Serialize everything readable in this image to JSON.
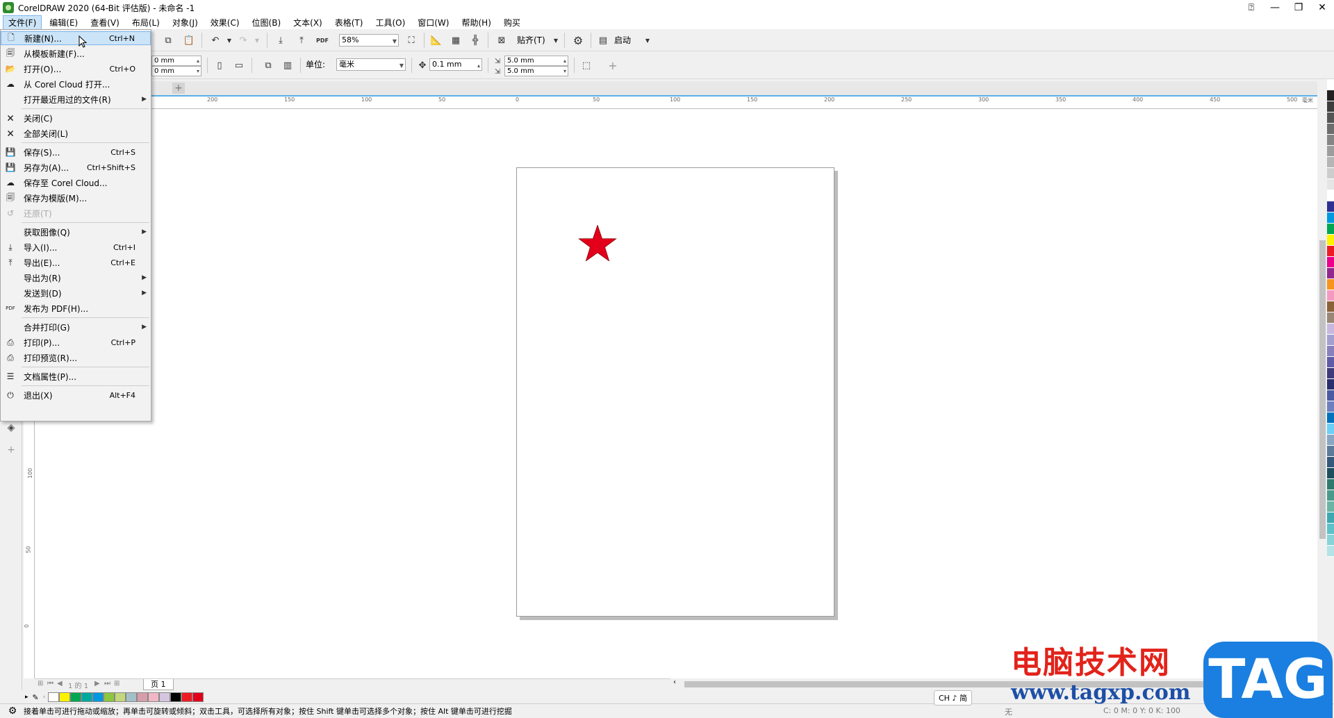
{
  "window": {
    "title": "CorelDRAW 2020 (64-Bit 评估版) - 未命名 -1",
    "controls": [
      "minimize-icon",
      "restore-icon",
      "close-icon"
    ]
  },
  "menubar": {
    "items": [
      "文件(F)",
      "编辑(E)",
      "查看(V)",
      "布局(L)",
      "对象(J)",
      "效果(C)",
      "位图(B)",
      "文本(X)",
      "表格(T)",
      "工具(O)",
      "窗口(W)",
      "帮助(H)",
      "购买"
    ],
    "active_index": 0
  },
  "toolbar1": {
    "zoom_value": "58%",
    "snap_label": "贴齐(T)",
    "launch_label": "启动",
    "pdf_label": "PDF"
  },
  "toolbar2": {
    "width_value": "0 mm",
    "height_value": "0 mm",
    "unit_label": "单位:",
    "unit_value": "毫米",
    "nudge_value": "0.1 mm",
    "dup_x_value": "5.0 mm",
    "dup_y_value": "5.0 mm"
  },
  "ruler": {
    "h_ticks": [
      "200",
      "150",
      "100",
      "50",
      "0",
      "50",
      "100",
      "150",
      "200",
      "250",
      "300",
      "350",
      "400",
      "450",
      "500"
    ],
    "h_unit": "毫米",
    "v_ticks": [
      "100",
      "50",
      "0"
    ]
  },
  "file_menu": {
    "items": [
      {
        "label": "新建(N)...",
        "shortcut": "Ctrl+N",
        "icon": "new-document-icon",
        "highlight": true
      },
      {
        "label": "从模板新建(F)...",
        "shortcut": "",
        "icon": "new-from-template-icon"
      },
      {
        "label": "打开(O)...",
        "shortcut": "Ctrl+O",
        "icon": "open-folder-icon"
      },
      {
        "label": "从 Corel Cloud 打开...",
        "shortcut": "",
        "icon": "cloud-download-icon"
      },
      {
        "label": "打开最近用过的文件(R)",
        "shortcut": "",
        "icon": "",
        "submenu": true
      },
      {
        "label": "关闭(C)",
        "shortcut": "",
        "icon": "close-document-icon"
      },
      {
        "label": "全部关闭(L)",
        "shortcut": "",
        "icon": "close-all-icon"
      },
      {
        "label": "保存(S)...",
        "shortcut": "Ctrl+S",
        "icon": "save-icon"
      },
      {
        "label": "另存为(A)...",
        "shortcut": "Ctrl+Shift+S",
        "icon": "save-as-icon"
      },
      {
        "label": "保存至 Corel Cloud...",
        "shortcut": "",
        "icon": "cloud-upload-icon"
      },
      {
        "label": "保存为模版(M)...",
        "shortcut": "",
        "icon": "save-template-icon"
      },
      {
        "label": "还原(T)",
        "shortcut": "",
        "icon": "revert-icon",
        "disabled": true
      },
      {
        "label": "获取图像(Q)",
        "shortcut": "",
        "icon": "",
        "submenu": true
      },
      {
        "label": "导入(I)...",
        "shortcut": "Ctrl+I",
        "icon": "import-icon"
      },
      {
        "label": "导出(E)...",
        "shortcut": "Ctrl+E",
        "icon": "export-icon"
      },
      {
        "label": "导出为(R)",
        "shortcut": "",
        "icon": "",
        "submenu": true
      },
      {
        "label": "发送到(D)",
        "shortcut": "",
        "icon": "",
        "submenu": true
      },
      {
        "label": "发布为 PDF(H)...",
        "shortcut": "",
        "icon": "pdf-icon"
      },
      {
        "label": "合并打印(G)",
        "shortcut": "",
        "icon": "",
        "submenu": true
      },
      {
        "label": "打印(P)...",
        "shortcut": "Ctrl+P",
        "icon": "print-icon"
      },
      {
        "label": "打印预览(R)...",
        "shortcut": "",
        "icon": "print-preview-icon"
      },
      {
        "label": "文档属性(P)...",
        "shortcut": "",
        "icon": "document-properties-icon"
      },
      {
        "label": "退出(X)",
        "shortcut": "Alt+F4",
        "icon": "power-icon"
      }
    ]
  },
  "pagestrip": {
    "page_counter": "1 的 1",
    "page_tab": "页 1"
  },
  "colors": {
    "star": "#e2001a",
    "accent": "#5aaee8",
    "menu_highlight": "#cce4f7",
    "palette": [
      "#ffffff",
      "#231f20",
      "#3d3d3d",
      "#555555",
      "#6d6d6d",
      "#858585",
      "#9d9d9d",
      "#b5b5b5",
      "#cdcdcd",
      "#e5e5e5",
      "#ffffff",
      "#2e3192",
      "#0099e0",
      "#00a651",
      "#fff200",
      "#ed1c24",
      "#ec008c",
      "#92278f",
      "#f7941d",
      "#f49ac1",
      "#8c6239",
      "#998675",
      "#c8b8e0",
      "#a3a0d0",
      "#8781bd",
      "#605ca8",
      "#3f3b7b",
      "#2a2e6e",
      "#4a5ba3",
      "#6e7fc0",
      "#0072bc",
      "#6dcff6",
      "#89a7c2",
      "#5c7a99",
      "#35597a",
      "#1f4e5f",
      "#2f7a6e",
      "#4a9a8c",
      "#6ab4a6",
      "#3ea8b0",
      "#5dc1c9",
      "#87d3d8",
      "#b3e3e6"
    ],
    "doc_palette": [
      "#ffffff",
      "#fff200",
      "#00a651",
      "#00a99d",
      "#0099e0",
      "#8dc63f",
      "#c4d87b",
      "#a3c0c8",
      "#d69ea8",
      "#f1b7c4",
      "#d6c5e0",
      "#000000",
      "#ed1c24",
      "#e2001a"
    ]
  },
  "statusbar": {
    "hint": "接着单击可进行拖动或缩放；再单击可旋转或倾斜；双击工具，可选择所有对象；按住 Shift 键单击可选择多个对象；按住 Alt 键单击可进行挖掘",
    "ime": "CH ♪ 简",
    "fill_none": "无",
    "cmyk": "C: 0 M: 0 Y: 0 K: 100"
  },
  "watermark": {
    "cn": "电脑技术网",
    "url": "www.tagxp.com",
    "tag": "TAG"
  }
}
